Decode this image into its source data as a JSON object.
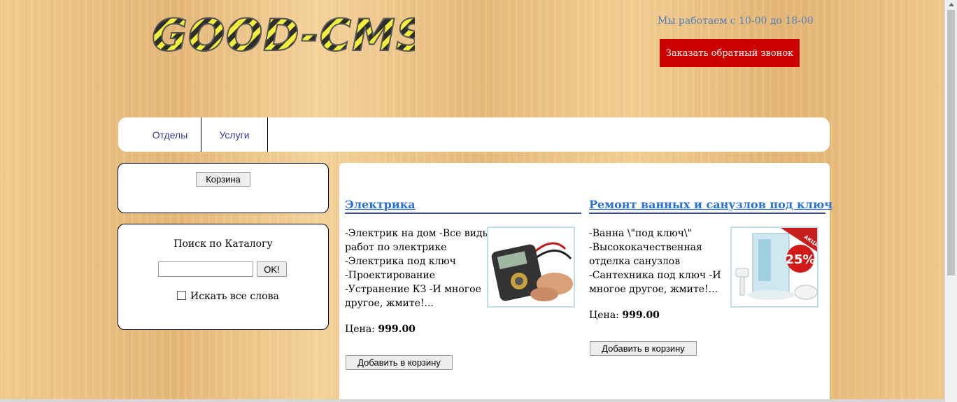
{
  "header": {
    "logo_text": "GOOD-CMS",
    "work_hours": "Мы работаем с 10-00 до 18-00",
    "callback_label": "Заказать обратный звонок"
  },
  "nav": {
    "items": [
      {
        "label": "Отделы"
      },
      {
        "label": "Услуги"
      }
    ]
  },
  "sidebar": {
    "cart_label": "Корзина",
    "search": {
      "title": "Поиск по Каталогу",
      "input_value": "",
      "ok_label": "OK!",
      "all_words_label": "Искать все слова",
      "all_words_checked": false
    }
  },
  "products": [
    {
      "title": "Электрика",
      "description": [
        "-Электрик на дом -Все виды",
        "работ по электрике",
        "-Электрика под ключ",
        "-Проектирование",
        "-Устранение КЗ -И многое",
        "другое, жмите!..."
      ],
      "price_label": "Цена:",
      "price_value": "999.00",
      "add_label": "Добавить в корзину",
      "image": "multimeter-image"
    },
    {
      "title": "Ремонт ванных и санузлов под ключ",
      "description": [
        "-Ванна \\\"под ключ\\\"",
        "-Высококачественная",
        "отделка санузлов",
        "-Сантехника под ключ -И",
        "многое другое, жмите!..."
      ],
      "price_label": "Цена:",
      "price_value": "999.00",
      "add_label": "Добавить в корзину",
      "image": "shower-cabin-image",
      "badge_text": "25%",
      "ribbon_text": "АКЦИЯ"
    }
  ],
  "colors": {
    "callback_bg": "#cc0000",
    "link": "#2b6fd9",
    "nav_text": "#3a3a9a",
    "hours_text": "#4f7fbf"
  }
}
